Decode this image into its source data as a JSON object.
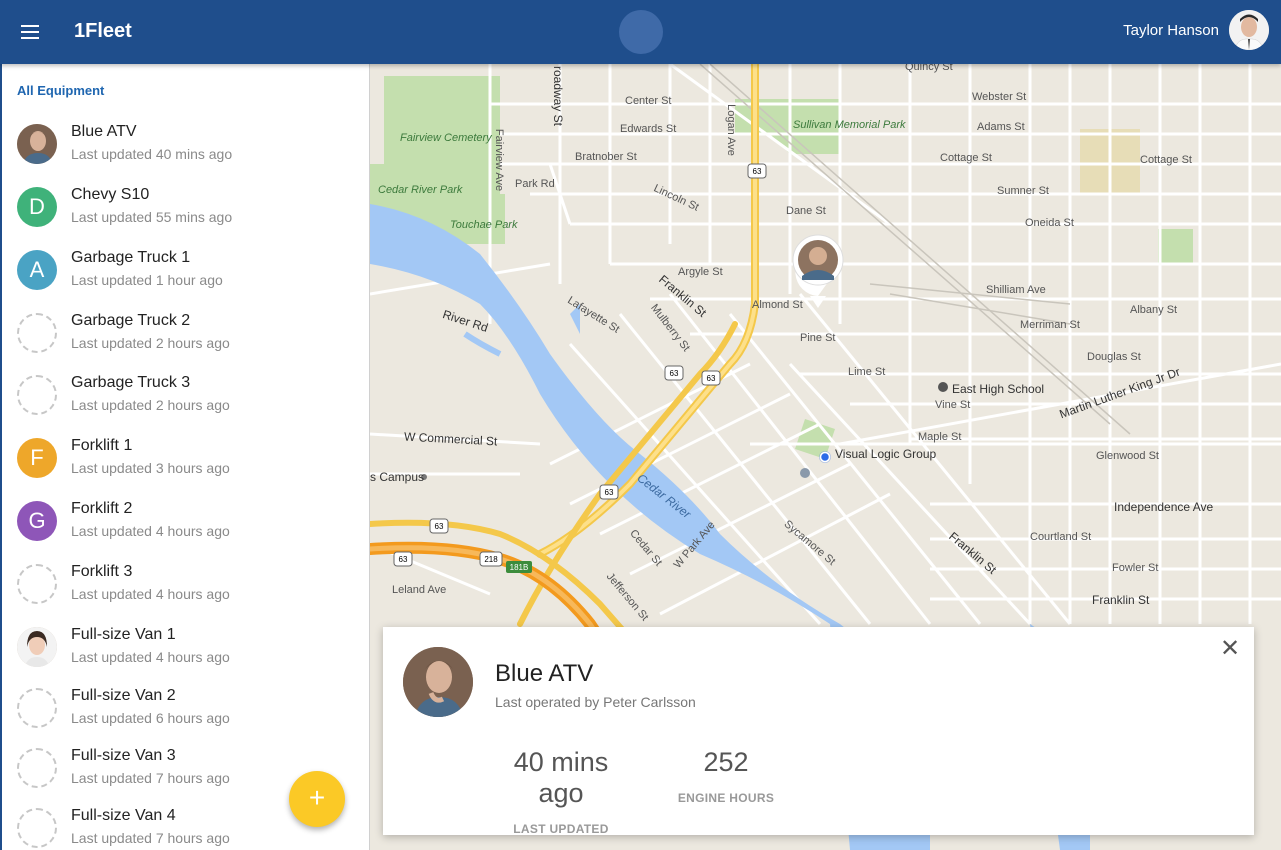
{
  "header": {
    "app_title": "1Fleet",
    "user_name": "Taylor Hanson",
    "brand_color": "#1f4e8c"
  },
  "sidebar": {
    "title": "All Equipment",
    "items": [
      {
        "name": "Blue ATV",
        "updated": "Last updated 40 mins ago",
        "avatar": "photo",
        "letter": "",
        "color": ""
      },
      {
        "name": "Chevy S10",
        "updated": "Last updated 55 mins ago",
        "avatar": "letter",
        "letter": "D",
        "color": "#3fb27a"
      },
      {
        "name": "Garbage Truck 1",
        "updated": "Last updated 1 hour ago",
        "avatar": "letter",
        "letter": "A",
        "color": "#4aa3c4"
      },
      {
        "name": "Garbage Truck 2",
        "updated": "Last updated 2 hours ago",
        "avatar": "empty",
        "letter": "",
        "color": ""
      },
      {
        "name": "Garbage Truck 3",
        "updated": "Last updated 2 hours ago",
        "avatar": "empty",
        "letter": "",
        "color": ""
      },
      {
        "name": "Forklift 1",
        "updated": "Last updated 3 hours ago",
        "avatar": "letter",
        "letter": "F",
        "color": "#eea72a"
      },
      {
        "name": "Forklift 2",
        "updated": "Last updated 4 hours ago",
        "avatar": "letter",
        "letter": "G",
        "color": "#8e56b8"
      },
      {
        "name": "Forklift 3",
        "updated": "Last updated 4 hours ago",
        "avatar": "empty",
        "letter": "",
        "color": ""
      },
      {
        "name": "Full-size Van 1",
        "updated": "Last updated 4 hours ago",
        "avatar": "photo2",
        "letter": "",
        "color": ""
      },
      {
        "name": "Full-size Van 2",
        "updated": "Last updated 6 hours ago",
        "avatar": "empty",
        "letter": "",
        "color": ""
      },
      {
        "name": "Full-size Van 3",
        "updated": "Last updated 7 hours ago",
        "avatar": "empty",
        "letter": "",
        "color": ""
      },
      {
        "name": "Full-size Van 4",
        "updated": "Last updated 7 hours ago",
        "avatar": "empty",
        "letter": "",
        "color": ""
      }
    ],
    "fab_label": "+"
  },
  "map": {
    "labels": {
      "fairview_cemetery": "Fairview Cemetery",
      "cedar_river_park": "Cedar River Park",
      "touchae_park": "Touchae Park",
      "sullivan_park": "Sullivan Memorial Park",
      "river_rd": "River Rd",
      "w_commercial": "W Commercial St",
      "campus": "s Campus",
      "cedar_river": "Cedar River",
      "visual_logic": "Visual Logic Group",
      "east_high": "East High School",
      "mlk": "Martin Luther King Jr Dr",
      "independence": "Independence Ave",
      "franklin_st": "Franklin St",
      "franklin_st2": "Franklin St",
      "franklin_st3": "Franklin St",
      "park_rd": "Park Rd",
      "bratnober": "Bratnober St",
      "edwards": "Edwards St",
      "center": "Center St",
      "adams": "Adams St",
      "webster": "Webster St",
      "quincy": "Quincy St",
      "cottage": "Cottage St",
      "cottage2": "Cottage St",
      "sumner": "Sumner St",
      "oneida": "Oneida St",
      "dane": "Dane St",
      "argyle": "Argyle St",
      "almond": "Almond St",
      "pine": "Pine St",
      "lime": "Lime St",
      "vine": "Vine St",
      "maple": "Maple St",
      "glenwood": "Glenwood St",
      "courtland": "Courtland St",
      "fowler": "Fowler St",
      "shilliam": "Shilliam Ave",
      "merriman": "Merriman St",
      "albany": "Albany St",
      "douglas": "Douglas St",
      "lafayette": "Lafayette St",
      "mulberry": "Mulberry St",
      "leland": "Leland Ave",
      "jefferson": "Jefferson St",
      "cedar_st": "Cedar St",
      "w_park": "W Park Ave",
      "sycamore": "Sycamore St",
      "lincoln": "Lincoln St",
      "logan": "Logan Ave",
      "fairview_ave": "Fairview Ave",
      "broadway": "roadway St",
      "route63": "63",
      "route218": "218",
      "exit181b": "181B"
    }
  },
  "card": {
    "title": "Blue ATV",
    "subtitle": "Last operated by Peter Carlsson",
    "stats": [
      {
        "value": "40 mins ago",
        "label": "LAST UPDATED"
      },
      {
        "value": "252",
        "label": "ENGINE HOURS"
      }
    ],
    "close_label": "✕"
  }
}
